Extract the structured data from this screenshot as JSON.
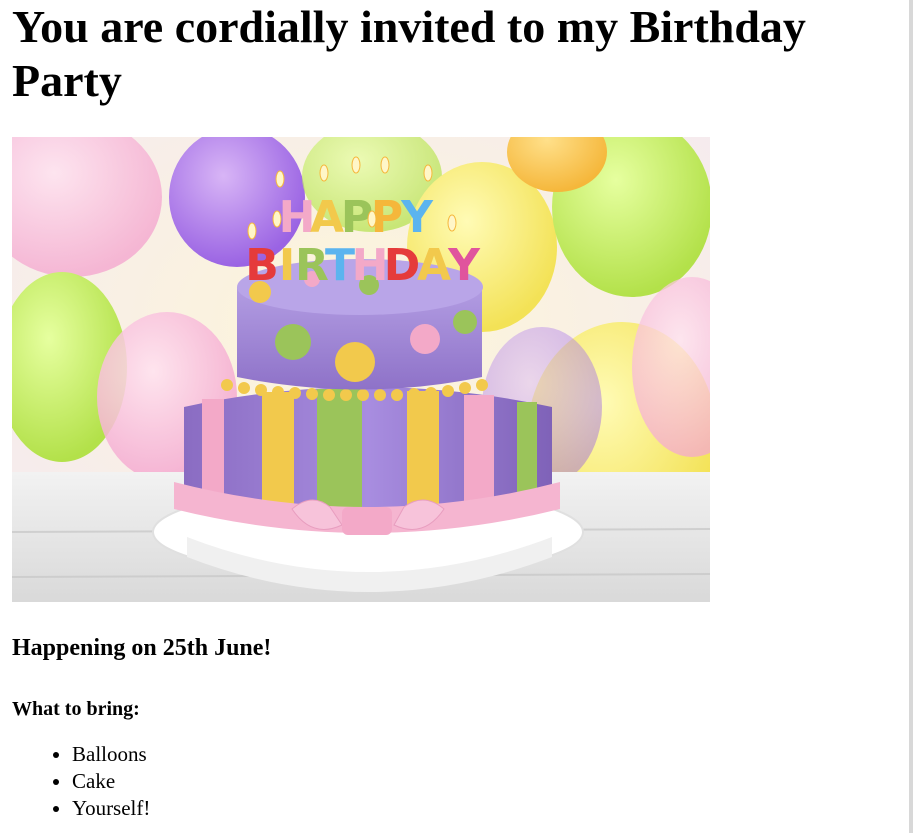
{
  "heading": "You are cordially invited to my Birthday Party",
  "subheading": "Happening on 25th June!",
  "bring_heading": "What to bring:",
  "bring_items": [
    "Balloons",
    "Cake",
    "Yourself!"
  ],
  "colors": {
    "background": "#ffffff",
    "cake_purple": "#9b7fd0",
    "cake_pink": "#f3a9c8",
    "cake_green": "#9bc45a",
    "cake_yellow": "#f2c94c"
  }
}
